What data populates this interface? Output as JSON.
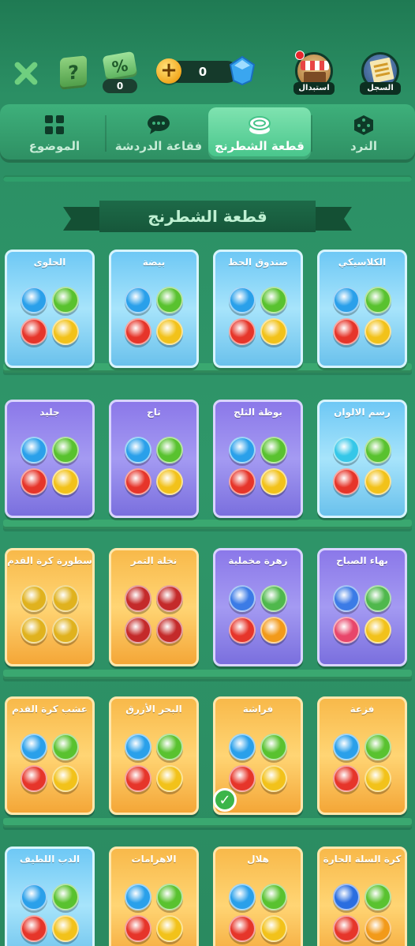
{
  "topbar": {
    "percent_count": "0",
    "percent_label": "%",
    "help_label": "?",
    "coins": "0",
    "store_label": "استبدال",
    "record_label": "السجل"
  },
  "tabs": [
    {
      "label": "النرد",
      "icon": "dice-icon",
      "active": false
    },
    {
      "label": "قطعة الشطرنج",
      "icon": "chess-piece-icon",
      "active": true
    },
    {
      "label": "فقاعة الدردشة",
      "icon": "chat-bubble-icon",
      "active": false
    },
    {
      "label": "الموضوع",
      "icon": "theme-icon",
      "active": false
    }
  ],
  "section": {
    "title": "قطعة الشطرنج"
  },
  "cards": [
    {
      "title": "الكلاسيكي",
      "theme": "blue",
      "style": "classic",
      "colors": [
        "#2aa0ea",
        "#59c22f",
        "#e6352a",
        "#f2c21a"
      ]
    },
    {
      "title": "صندوق الحظ",
      "theme": "blue",
      "style": "chest",
      "colors": [
        "#2aa0ea",
        "#59c22f",
        "#e6352a",
        "#f2c21a"
      ]
    },
    {
      "title": "بيضة",
      "theme": "blue",
      "style": "egg",
      "colors": [
        "#2aa0ea",
        "#59c22f",
        "#e6352a",
        "#f2c21a"
      ]
    },
    {
      "title": "الحلوى",
      "theme": "blue",
      "style": "candy",
      "colors": [
        "#2aa0ea",
        "#59c22f",
        "#e6352a",
        "#f2c21a"
      ]
    },
    {
      "title": "رسم الالوان",
      "theme": "blue",
      "style": "paint",
      "colors": [
        "#35c7e8",
        "#59c22f",
        "#e6352a",
        "#f2c21a"
      ]
    },
    {
      "title": "بوظة الثلج",
      "theme": "purple",
      "style": "icecream",
      "colors": [
        "#2aa0ea",
        "#59c22f",
        "#e6352a",
        "#f2c21a"
      ]
    },
    {
      "title": "تاج",
      "theme": "purple",
      "style": "crown",
      "colors": [
        "#2aa0ea",
        "#59c22f",
        "#e6352a",
        "#f2c21a"
      ]
    },
    {
      "title": "جليد",
      "theme": "purple",
      "style": "snowman",
      "colors": [
        "#2aa0ea",
        "#59c22f",
        "#e6352a",
        "#f2c21a"
      ]
    },
    {
      "title": "بهاء الصباح",
      "theme": "purple",
      "style": "flower",
      "colors": [
        "#3b7be6",
        "#4fb84c",
        "#e8466a",
        "#f2c21a"
      ]
    },
    {
      "title": "زهرة مخملية",
      "theme": "purple",
      "style": "rose",
      "colors": [
        "#3b7be6",
        "#4fb84c",
        "#e6352a",
        "#f29a1a"
      ]
    },
    {
      "title": "نخلة التمر",
      "theme": "orange",
      "style": "date",
      "colors": [
        "#c42a2a",
        "#c42a2a",
        "#c42a2a",
        "#c42a2a"
      ]
    },
    {
      "title": "أسطورة كرة القدم",
      "theme": "orange",
      "style": "trophy",
      "colors": [
        "#e0b21e",
        "#e0b21e",
        "#e0b21e",
        "#e0b21e"
      ]
    },
    {
      "title": "فزعة",
      "theme": "orange",
      "style": "ring",
      "colors": [
        "#2aa0ea",
        "#59c22f",
        "#e6352a",
        "#f2c21a"
      ]
    },
    {
      "title": "فراشة",
      "theme": "orange",
      "style": "butterfly",
      "colors": [
        "#2aa0ea",
        "#59c22f",
        "#e6352a",
        "#f2c21a"
      ]
    },
    {
      "title": "البحر الأزرق",
      "theme": "orange",
      "style": "star",
      "colors": [
        "#2aa0ea",
        "#59c22f",
        "#e6352a",
        "#f2c21a"
      ]
    },
    {
      "title": "عشب كرة القدم",
      "theme": "orange",
      "style": "ball",
      "colors": [
        "#2aa0ea",
        "#59c22f",
        "#e6352a",
        "#f2c21a"
      ]
    },
    {
      "title": "كرة السلة الحارة",
      "theme": "orange",
      "style": "basketball",
      "colors": [
        "#2a6ee0",
        "#59c22f",
        "#e6352a",
        "#f29a1a"
      ]
    },
    {
      "title": "هلال",
      "theme": "orange",
      "style": "crescent",
      "colors": [
        "#2aa0ea",
        "#59c22f",
        "#e6352a",
        "#f2c21a"
      ]
    },
    {
      "title": "الاهرامات",
      "theme": "orange",
      "style": "pyramid",
      "colors": [
        "#2aa0ea",
        "#59c22f",
        "#e6352a",
        "#f2c21a"
      ]
    },
    {
      "title": "الدب اللطيف",
      "theme": "blue",
      "style": "bear",
      "colors": [
        "#2aa0ea",
        "#59c22f",
        "#e6352a",
        "#f2c21a"
      ]
    }
  ],
  "selected_card_index": 13
}
